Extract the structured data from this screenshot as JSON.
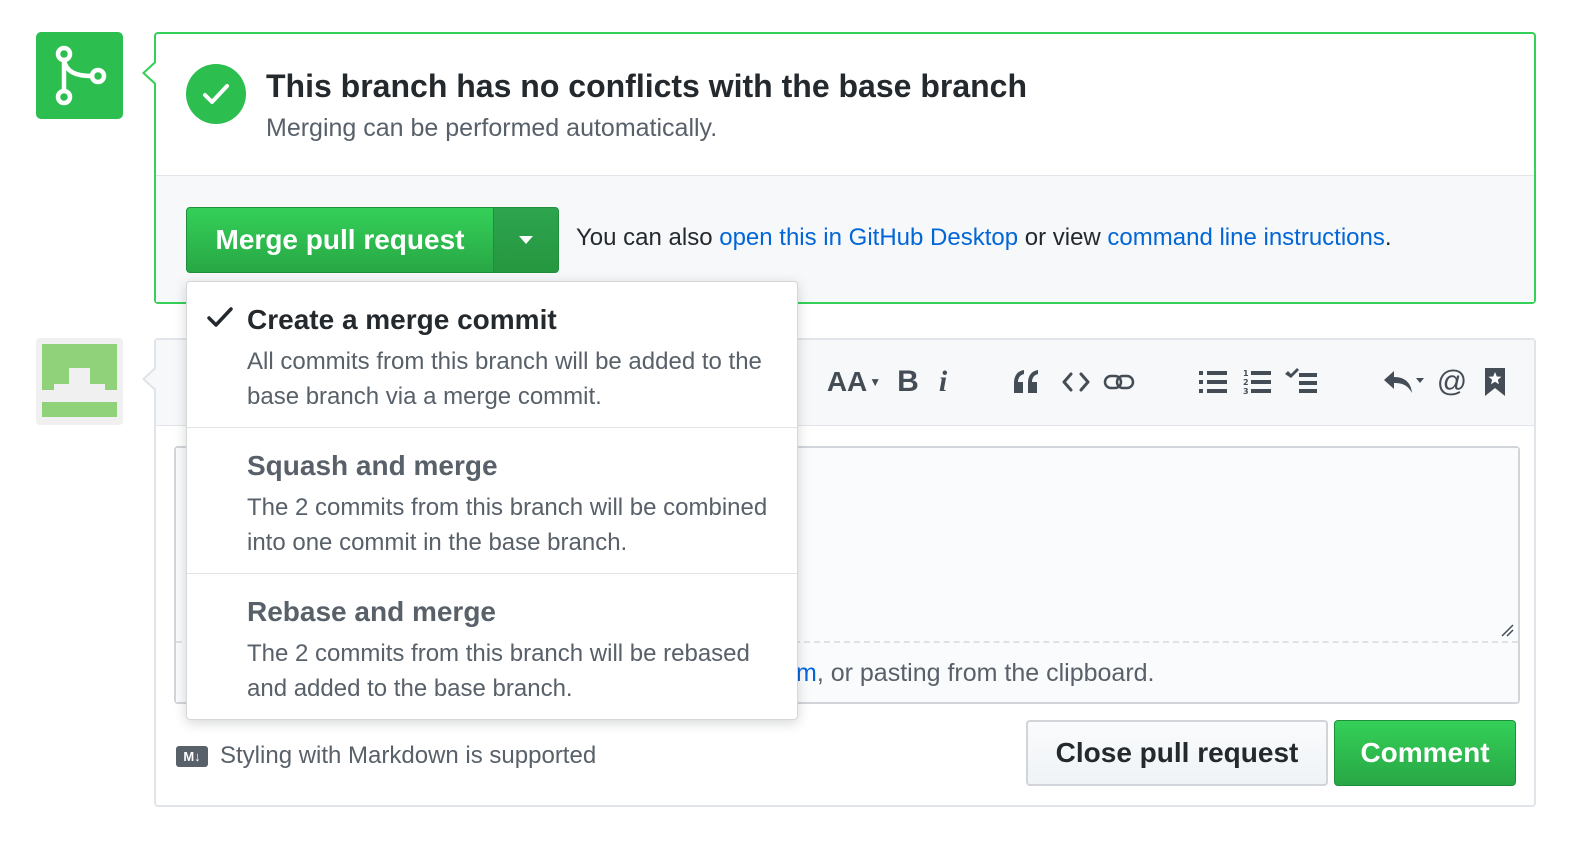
{
  "merge_status": {
    "title": "This branch has no conflicts with the base branch",
    "subtitle": "Merging can be performed automatically.",
    "merge_button_label": "Merge pull request",
    "also_prefix": "You can also ",
    "desktop_link": "open this in GitHub Desktop",
    "also_middle": " or view ",
    "cli_link": "command line instructions",
    "also_suffix": ".",
    "icons": {
      "timeline": "git-merge-icon",
      "status": "check-icon",
      "dropdown": "triangle-down-icon"
    }
  },
  "merge_menu": {
    "items": [
      {
        "title": "Create a merge commit",
        "description": "All commits from this branch will be added to the base branch via a merge commit.",
        "selected": true
      },
      {
        "title": "Squash and merge",
        "description": "The 2 commits from this branch will be combined into one commit in the base branch.",
        "selected": false
      },
      {
        "title": "Rebase and merge",
        "description": "The 2 commits from this branch will be rebased and added to the base branch.",
        "selected": false
      }
    ]
  },
  "comment_form": {
    "toolbar_icons": [
      "text-size-icon",
      "bold-icon",
      "italic-icon",
      "quote-icon",
      "code-icon",
      "link-icon",
      "unordered-list-icon",
      "ordered-list-icon",
      "tasklist-icon",
      "reply-icon",
      "mention-icon",
      "bookmark-icon"
    ],
    "drop_hint_link_fragment": "m",
    "drop_hint_text": ", or pasting from the clipboard.",
    "markdown_badge": "M↓",
    "markdown_note": "Styling with Markdown is supported",
    "close_button_label": "Close pull request",
    "comment_button_label": "Comment"
  },
  "colors": {
    "success": "#2cbe4e",
    "success_border": "#34d058",
    "link": "#0366d6",
    "muted": "#586069"
  }
}
